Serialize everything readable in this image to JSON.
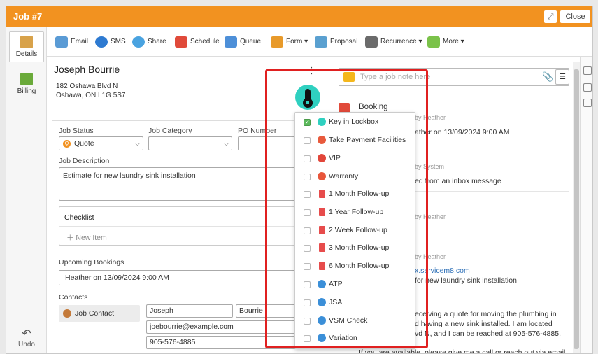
{
  "window": {
    "title": "Job #7",
    "close_label": "Close",
    "expand_icon": "expand-icon"
  },
  "leftnav": {
    "items": [
      {
        "label": "Details",
        "icon": "details-icon",
        "active": true
      },
      {
        "label": "Billing",
        "icon": "billing-icon",
        "active": false
      }
    ],
    "undo_label": "Undo"
  },
  "toolbar": {
    "items": [
      {
        "label": "Email",
        "icon": "email-icon"
      },
      {
        "label": "SMS",
        "icon": "sms-icon"
      },
      {
        "label": "Share",
        "icon": "share-icon"
      },
      {
        "label": "Schedule",
        "icon": "schedule-icon"
      },
      {
        "label": "Queue",
        "icon": "queue-icon"
      },
      {
        "label": "Form",
        "icon": "form-icon"
      },
      {
        "label": "Proposal",
        "icon": "proposal-icon"
      },
      {
        "label": "Recurrence",
        "icon": "recurrence-icon"
      },
      {
        "label": "More",
        "icon": "more-icon"
      }
    ]
  },
  "customer": {
    "name": "Joseph Bourrie",
    "address_line1": "182 Oshawa Blvd N",
    "address_line2": "Oshawa, ON L1G 5S7"
  },
  "job": {
    "status_label": "Job Status",
    "status_value": "Quote",
    "category_label": "Job Category",
    "category_value": "",
    "po_label": "PO Number",
    "po_value": "",
    "description_label": "Job Description",
    "description_value": "Estimate for new laundry sink installation"
  },
  "checklist": {
    "title": "Checklist",
    "new_item": "New Item"
  },
  "bookings": {
    "label": "Upcoming Bookings",
    "value": "Heather on 13/09/2024 9:00 AM"
  },
  "contacts": {
    "label": "Contacts",
    "chip": "Job Contact",
    "first_name": "Joseph",
    "last_name": "Bourrie",
    "email": "joebourrie@example.com",
    "phone": "905-576-4885"
  },
  "notes": {
    "placeholder": "Type a job note here",
    "attach_icon": "paperclip-icon",
    "filter_icon": "filter-icon"
  },
  "feed": {
    "booking_title": "Booking",
    "by_heather": "by Heather",
    "booking_text": "ather on 13/09/2024 9:00 AM",
    "by_system": "by System",
    "system_text": "ed from an inbox message",
    "by_heather_2": "by Heather",
    "by_heather_3": "by Heather",
    "link_text": "x.servicem8.com",
    "subject": "for new laundry sink installation",
    "body1": "eceiving a quote for moving the plumbing in",
    "body2": "d having a new sink installed. I am located",
    "body3": "vd N, and I can be reached at 905-576-4885.",
    "body4": "If you are available, please give me a call or reach out via email"
  },
  "badge_menu": {
    "items": [
      {
        "label": "Key in Lockbox",
        "checked": true,
        "icon": "key-icon",
        "color": "#2fd0c0"
      },
      {
        "label": "Take Payment Facilities",
        "checked": false,
        "icon": "payment-icon",
        "color": "#e85a3c"
      },
      {
        "label": "VIP",
        "checked": false,
        "icon": "vip-icon",
        "color": "#e2463a"
      },
      {
        "label": "Warranty",
        "checked": false,
        "icon": "warranty-icon",
        "color": "#e8553a"
      },
      {
        "label": "1 Month Follow-up",
        "checked": false,
        "icon": "flag-icon",
        "color": "#e74c4c"
      },
      {
        "label": "1 Year Follow-up",
        "checked": false,
        "icon": "flag-icon",
        "color": "#e74c4c"
      },
      {
        "label": "2 Week Follow-up",
        "checked": false,
        "icon": "flag-icon",
        "color": "#e74c4c"
      },
      {
        "label": "3 Month Follow-up",
        "checked": false,
        "icon": "flag-icon",
        "color": "#e74c4c"
      },
      {
        "label": "6 Month Follow-up",
        "checked": false,
        "icon": "flag-icon",
        "color": "#e74c4c"
      },
      {
        "label": "ATP",
        "checked": false,
        "icon": "atp-icon",
        "color": "#3b8fd8"
      },
      {
        "label": "JSA",
        "checked": false,
        "icon": "jsa-icon",
        "color": "#3b8fd8"
      },
      {
        "label": "VSM Check",
        "checked": false,
        "icon": "vsm-icon",
        "color": "#3b8fd8"
      },
      {
        "label": "Variation",
        "checked": false,
        "icon": "variation-icon",
        "color": "#3b8fd8"
      }
    ]
  },
  "colors": {
    "accent": "#f29220",
    "highlight": "#e02020",
    "badge": "#2fd0c0"
  }
}
